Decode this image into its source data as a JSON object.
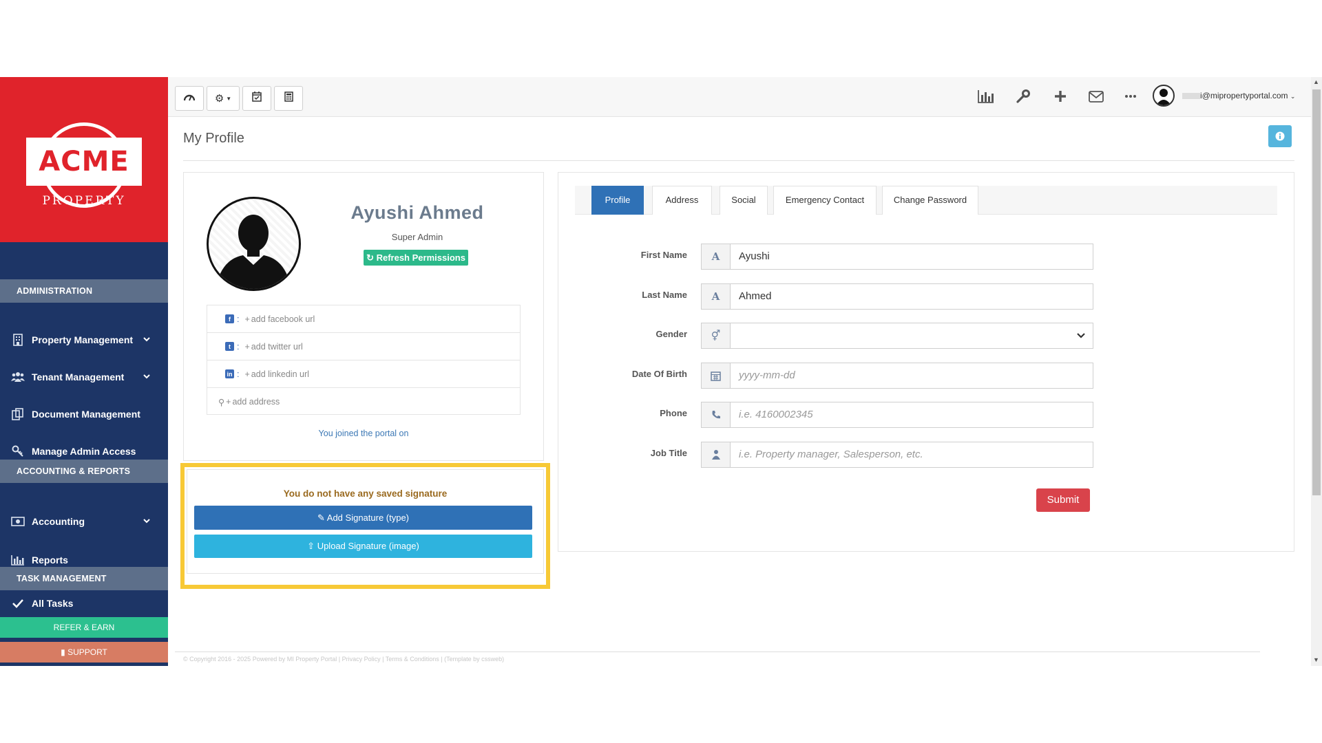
{
  "brand": {
    "logo_text": "ACME",
    "logo_sub": "PROPERTY",
    "color_red": "#e0232b",
    "color_navy": "#1d3566"
  },
  "sidebar": {
    "sections": [
      {
        "label": "ADMINISTRATION"
      },
      {
        "label": "ACCOUNTING & REPORTS"
      },
      {
        "label": "TASK MANAGEMENT"
      }
    ],
    "items": [
      {
        "label": "Property Management",
        "icon": "building-icon"
      },
      {
        "label": "Tenant Management",
        "icon": "users-icon"
      },
      {
        "label": "Document Management",
        "icon": "documents-icon"
      },
      {
        "label": "Manage Admin Access",
        "icon": "key-icon"
      },
      {
        "label": "Accounting",
        "icon": "money-icon"
      },
      {
        "label": "Reports",
        "icon": "bar-chart-icon"
      },
      {
        "label": "All Tasks",
        "icon": "check-icon"
      }
    ],
    "refer_label": "REFER & EARN",
    "support_label": "SUPPORT"
  },
  "topbar": {
    "user_email": "i@mipropertyportal.com"
  },
  "page": {
    "title": "My Profile"
  },
  "profile": {
    "name": "Ayushi Ahmed",
    "role": "Super Admin",
    "refresh_label": "Refresh Permissions",
    "social": {
      "facebook": "add facebook url",
      "twitter": "add twitter url",
      "linkedin": "add linkedin url",
      "address": "add address"
    },
    "joined_text": "You joined the portal on"
  },
  "signature": {
    "empty_text": "You do not have any saved signature",
    "add_label": "Add Signature (type)",
    "upload_label": "Upload Signature (image)"
  },
  "tabs": [
    {
      "label": "Profile",
      "active": true
    },
    {
      "label": "Address",
      "active": false
    },
    {
      "label": "Social",
      "active": false
    },
    {
      "label": "Emergency Contact",
      "active": false
    },
    {
      "label": "Change Password",
      "active": false
    }
  ],
  "form": {
    "first_name": {
      "label": "First Name",
      "value": "Ayushi"
    },
    "last_name": {
      "label": "Last Name",
      "value": "Ahmed"
    },
    "gender": {
      "label": "Gender",
      "value": ""
    },
    "dob": {
      "label": "Date Of Birth",
      "placeholder": "yyyy-mm-dd"
    },
    "phone": {
      "label": "Phone",
      "placeholder": "i.e. 4160002345"
    },
    "job_title": {
      "label": "Job Title",
      "placeholder": "i.e. Property manager, Salesperson, etc."
    },
    "submit_label": "Submit"
  },
  "footer": {
    "text": "© Copyright 2016 - 2025 Powered by MI Property Portal | Privacy Policy | Terms & Conditions | (Template by cssweb)"
  }
}
